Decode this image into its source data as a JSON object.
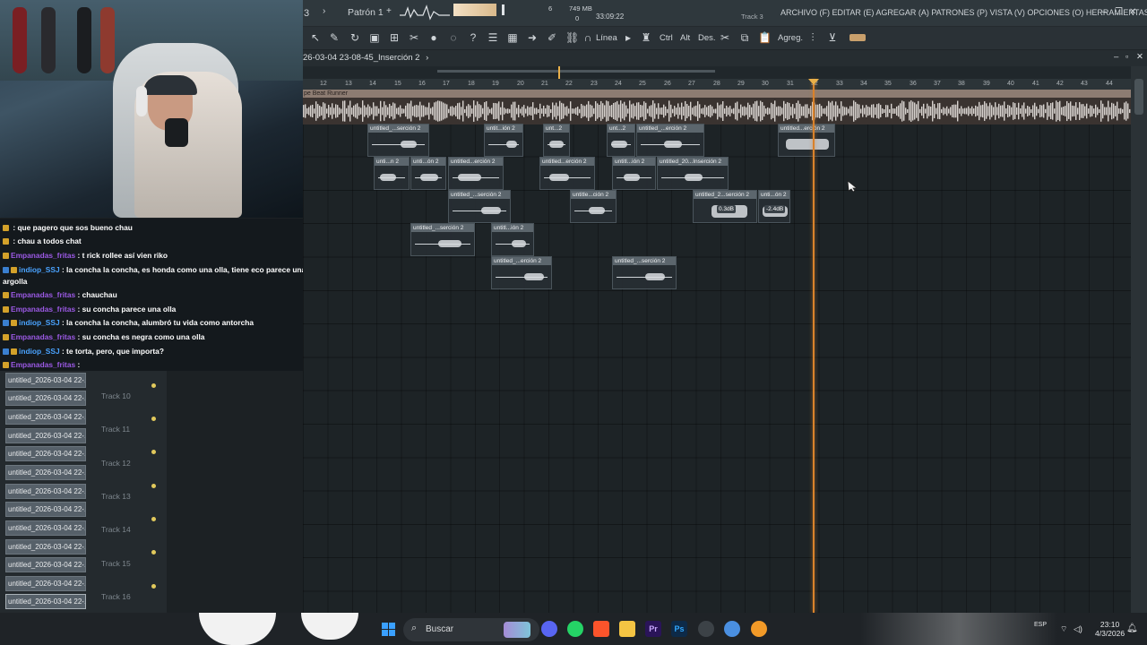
{
  "topbar": {
    "mode_num": "3",
    "pattern": "Patrón 1",
    "cpu_num": "6",
    "memory": "749 MB",
    "voices": "0",
    "time": "33:09:22",
    "hint": "Track 3",
    "menu": "ARCHIVO (F) EDITAR (E) AGREGAR (A) PATRONES (P) VISTA (V) OPCIONES (O) HERRAMIENTAS (T) AYUDA"
  },
  "toolbar": {
    "line_label": "Línea",
    "ctrl_label": "Ctrl",
    "alt_label": "Alt",
    "des_label": "Des.",
    "add_label": "Agreg."
  },
  "playlist": {
    "title": "26-03-04 23-08-45_Inserción 2",
    "reference_label": "pe Beat Runner",
    "ruler": [
      "12",
      "13",
      "14",
      "15",
      "16",
      "17",
      "18",
      "19",
      "20",
      "21",
      "22",
      "23",
      "24",
      "25",
      "26",
      "27",
      "28",
      "29",
      "30",
      "31",
      "32",
      "33",
      "34",
      "35",
      "36",
      "37",
      "38",
      "39",
      "40",
      "41",
      "42",
      "43",
      "44"
    ],
    "clips": [
      {
        "label": "untitled_...serción 2"
      },
      {
        "label": "untit...ión 2"
      },
      {
        "label": "unt...2"
      },
      {
        "label": "unt...2"
      },
      {
        "label": "untitled_...erción 2"
      },
      {
        "label": "untitled...erción 2"
      },
      {
        "label": "unti...n 2"
      },
      {
        "label": "unti...ón 2"
      },
      {
        "label": "untitled...erción 2"
      },
      {
        "label": "untitled...erción 2"
      },
      {
        "label": "untitl...ión 2"
      },
      {
        "label": "untitled_20...Inserción 2"
      },
      {
        "label": "untitled_...serción 2"
      },
      {
        "label": "untitle...ción 2"
      },
      {
        "label": "untitled_2...serción 2"
      },
      {
        "label": "unti...ón 2"
      },
      {
        "label": "untitled_...serción 2"
      },
      {
        "label": "untitl...ión 2"
      },
      {
        "label": "untitled_...erción 2"
      },
      {
        "label": "untitled_...serción 2"
      }
    ],
    "volumes": [
      "0.3dB",
      "-2.4dB"
    ]
  },
  "chat": [
    {
      "user": "",
      "text": ": que pagero que sos bueno chau"
    },
    {
      "user": "",
      "text": ": chau a todos chat"
    },
    {
      "user": "Empanadas_fritas",
      "text": ": t rick rollee así vien riko"
    },
    {
      "user": "indiop_SSJ",
      "text": ": la concha la concha, es honda como una olla, tiene eco parece una"
    },
    {
      "user": "",
      "text": "argolla"
    },
    {
      "user": "Empanadas_fritas",
      "text": ": chauchau"
    },
    {
      "user": "Empanadas_fritas",
      "text": ": su concha parece una olla"
    },
    {
      "user": "indiop_SSJ",
      "text": ": la concha la concha, alumbró tu vida como antorcha"
    },
    {
      "user": "Empanadas_fritas",
      "text": ": su concha es negra como una olla"
    },
    {
      "user": "indiop_SSJ",
      "text": ": te torta, pero, que importa?"
    },
    {
      "user": "Empanadas_fritas",
      "text": ":"
    }
  ],
  "tracks": {
    "clip_item": "untitled_2026-03-04 22-...",
    "labels": [
      "Track 10",
      "Track 11",
      "Track 12",
      "Track 13",
      "Track 14",
      "Track 15",
      "Track 16"
    ]
  },
  "taskbar": {
    "search_placeholder": "Buscar",
    "lang": "ESP",
    "time": "23:10",
    "date": "4/3/2026"
  },
  "colors": {
    "playhead": "#d9822b",
    "clip_header": "#5c666d",
    "reference_track": "#8d7c72",
    "user_purple": "#9b59e4"
  }
}
